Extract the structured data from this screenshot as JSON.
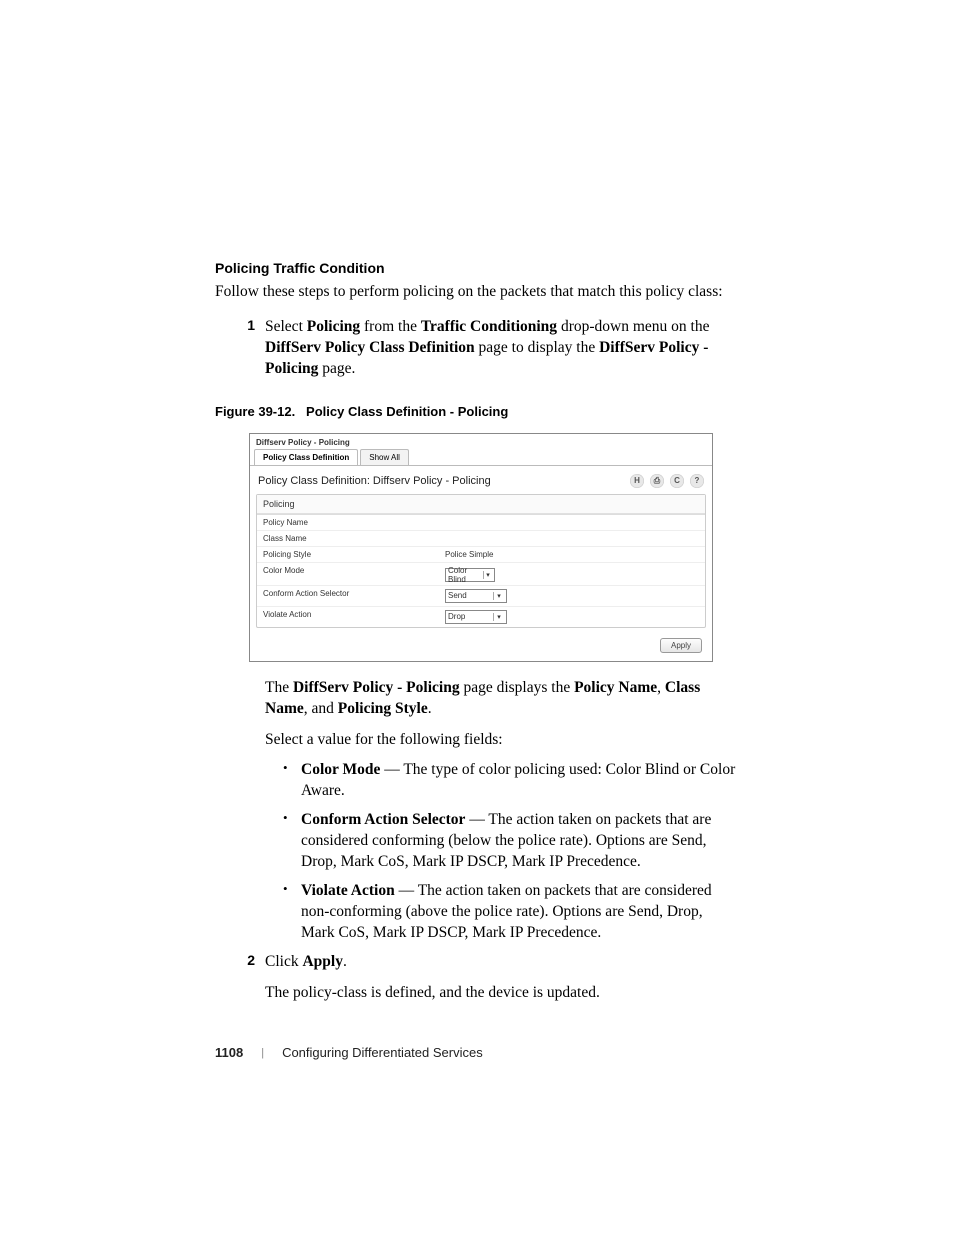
{
  "heading": "Policing Traffic Condition",
  "intro": "Follow these steps to perform policing on the packets that match this policy class:",
  "step1_num": "1",
  "step1_pre": "Select ",
  "step1_b1": "Policing",
  "step1_mid1": " from the ",
  "step1_b2": "Traffic Conditioning",
  "step1_mid2": " drop-down menu on the ",
  "step1_b3": "DiffServ Policy Class Definition",
  "step1_mid3": " page to display the ",
  "step1_b4": "DiffServ Policy - Policing",
  "step1_end": " page.",
  "fig_caption_a": "Figure 39-12.",
  "fig_caption_b": "Policy Class Definition - Policing",
  "shot": {
    "breadcrumb": "Diffserv Policy - Policing",
    "tab1": "Policy Class Definition",
    "tab2": "Show All",
    "title": "Policy Class Definition: Diffserv Policy - Policing",
    "icon_save": "H",
    "icon_print": "⎙",
    "icon_refresh": "C",
    "icon_help": "?",
    "section": "Policing",
    "rows": {
      "policy_name": "Policy Name",
      "class_name": "Class Name",
      "policing_style": "Policing Style",
      "policing_style_val": "Police Simple",
      "color_mode": "Color Mode",
      "color_mode_val": "Color Blind",
      "conform": "Conform Action Selector",
      "conform_val": "Send",
      "violate": "Violate Action",
      "violate_val": "Drop"
    },
    "apply": "Apply"
  },
  "after_fig_pre": "The ",
  "after_fig_b1": "DiffServ Policy - Policing",
  "after_fig_mid1": " page displays the ",
  "after_fig_b2": "Policy Name",
  "after_fig_mid2": ", ",
  "after_fig_b3": "Class Name",
  "after_fig_mid3": ", and ",
  "after_fig_b4": "Policing Style",
  "after_fig_end": ".",
  "select_line": "Select a value for the following fields:",
  "bullets": {
    "b1_label": "Color Mode",
    "b1_text": " — The type of color policing used: Color Blind or Color Aware.",
    "b2_label": "Conform Action Selector",
    "b2_text": " — The action taken on packets that are considered conforming (below the police rate). Options are Send, Drop, Mark CoS, Mark IP DSCP, Mark IP Precedence.",
    "b3_label": "Violate Action",
    "b3_text": " — The action taken on packets that are considered non-conforming (above the police rate). Options are Send, Drop, Mark CoS, Mark IP DSCP, Mark IP Precedence."
  },
  "step2_num": "2",
  "step2_pre": "Click ",
  "step2_b": "Apply",
  "step2_end": ".",
  "closing": "The policy-class is defined, and the device is updated.",
  "footer_page": "1108",
  "footer_text": "Configuring Differentiated Services"
}
